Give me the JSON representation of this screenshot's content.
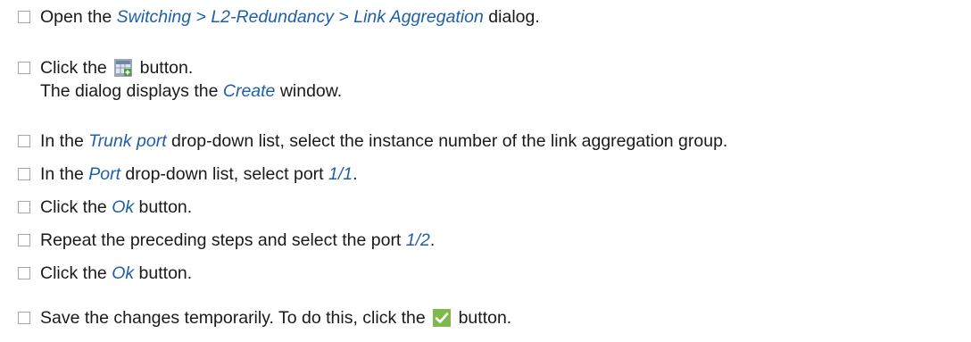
{
  "steps": [
    {
      "before": "Open the ",
      "ref": "Switching > L2-Redundancy > Link Aggregation",
      "after": " dialog."
    },
    {
      "before": "Click the ",
      "icon": "create-table-icon",
      "after": " button.",
      "line2": "The dialog displays the ",
      "line2_ref": "Create",
      "line2_after": " window."
    },
    {
      "before": "In the ",
      "ref": "Trunk port",
      "after": " drop-down list, select the instance number of the link aggregation group."
    },
    {
      "before": "In the ",
      "ref": "Port",
      "middle": " drop-down list, select port ",
      "ref2": "1/1",
      "after": "."
    },
    {
      "before": "Click the ",
      "ref": "Ok",
      "after": " button."
    },
    {
      "before": "Repeat the preceding steps and select the port ",
      "ref": "1/2",
      "after": "."
    },
    {
      "before": "Click the ",
      "ref": "Ok",
      "after": " button."
    },
    {
      "before": "Save the changes temporarily. To do this, click the ",
      "icon": "checkmark-icon",
      "after": " button."
    }
  ],
  "colors": {
    "reference": "#1f5fa8",
    "text": "#1a1a1a",
    "checkbox_border": "#a6a6a6",
    "checkmark_icon_bg": "#7fb94a"
  }
}
